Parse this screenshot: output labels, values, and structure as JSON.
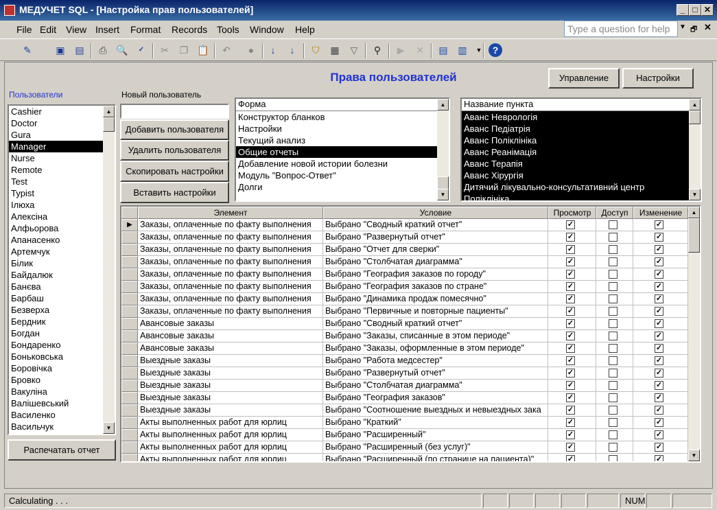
{
  "window": {
    "title": "МЕДУЧЕТ SQL - [Настройка прав пользователей]",
    "minimize": "_",
    "maximize": "□",
    "close": "✕"
  },
  "menu": {
    "items": [
      "File",
      "Edit",
      "View",
      "Insert",
      "Format",
      "Records",
      "Tools",
      "Window",
      "Help"
    ],
    "help_placeholder": "Type a question for help"
  },
  "toolbar": {
    "icons": [
      "design-view-icon",
      "save-icon",
      "file-search-icon",
      "print-icon",
      "print-preview-icon",
      "spelling-icon",
      "cut-icon",
      "copy-icon",
      "paste-icon",
      "undo-icon",
      "hyperlink-icon",
      "sort-ascending-icon",
      "sort-descending-icon",
      "filter-by-selection-icon",
      "filter-by-form-icon",
      "apply-filter-icon",
      "find-icon",
      "new-record-icon",
      "delete-record-icon",
      "database-window-icon",
      "new-object-icon",
      "help-icon"
    ]
  },
  "form": {
    "title": "Права пользователей",
    "btn_manage": "Управление",
    "btn_settings": "Настройки",
    "users_label": "Пользователи",
    "new_user_label": "Новый пользователь",
    "new_user_value": "",
    "btn_add_user": "Добавить пользователя",
    "btn_delete_user": "Удалить пользователя",
    "btn_copy_settings": "Скопировать настройки",
    "btn_paste_settings": "Вставить настройки",
    "btn_print_report": "Распечатать отчет"
  },
  "users": [
    "Cashier",
    "Doctor",
    "Gura",
    "Manager",
    "Nurse",
    "Remote",
    "Test",
    "Typist",
    "Ілюха",
    "Алексіна",
    "Алфьорова",
    "Апанасенко",
    "Артемчук",
    "Білик",
    "Байдалюк",
    "Банєва",
    "Барбаш",
    "Безверха",
    "Бердник",
    "Богдан",
    "Бондаренко",
    "Боньковська",
    "Боровічка",
    "Бровко",
    "Вакуліна",
    "Валішевський",
    "Василенко",
    "Васильчук"
  ],
  "users_selected": "Manager",
  "forms": {
    "header": "Форма",
    "items": [
      "Конструктор бланков",
      "Настройки",
      "Текущий анализ",
      "Общие отчеты",
      "Добавление новой истории болезни",
      "Модуль \"Вопрос-Ответ\"",
      "Долги"
    ],
    "selected": "Общие отчеты"
  },
  "points": {
    "header": "Название пункта",
    "items": [
      "Аванс Неврологія",
      "Аванс Педіатрія",
      "Аванс Поліклініка",
      "Аванс Реанімація",
      "Аванс Терапія",
      "Аванс Хірургія",
      "Дитячий лікувально-консультативний центр",
      "Поліклініка"
    ]
  },
  "grid": {
    "columns": [
      "Элемент",
      "Условие",
      "Просмотр",
      "Доступ",
      "Изменение"
    ],
    "rows": [
      {
        "element": "Заказы, оплаченные по факту выполнения",
        "condition": "Выбрано \"Сводный краткий отчет\"",
        "view": true,
        "access": false,
        "edit": true
      },
      {
        "element": "Заказы, оплаченные по факту выполнения",
        "condition": "Выбрано \"Развернутый отчет\"",
        "view": true,
        "access": false,
        "edit": true
      },
      {
        "element": "Заказы, оплаченные по факту выполнения",
        "condition": "Выбрано \"Отчет для сверки\"",
        "view": true,
        "access": false,
        "edit": true
      },
      {
        "element": "Заказы, оплаченные по факту выполнения",
        "condition": "Выбрано \"Столбчатая диаграмма\"",
        "view": true,
        "access": false,
        "edit": true
      },
      {
        "element": "Заказы, оплаченные по факту выполнения",
        "condition": "Выбрано \"География заказов по городу\"",
        "view": true,
        "access": false,
        "edit": true
      },
      {
        "element": "Заказы, оплаченные по факту выполнения",
        "condition": "Выбрано \"География заказов по стране\"",
        "view": true,
        "access": false,
        "edit": true
      },
      {
        "element": "Заказы, оплаченные по факту выполнения",
        "condition": "Выбрано \"Динамика продаж помесячно\"",
        "view": true,
        "access": false,
        "edit": true
      },
      {
        "element": "Заказы, оплаченные по факту выполнения",
        "condition": "Выбрано \"Первичные и повторные пациенты\"",
        "view": true,
        "access": false,
        "edit": true
      },
      {
        "element": "Авансовые заказы",
        "condition": "Выбрано \"Сводный краткий отчет\"",
        "view": true,
        "access": false,
        "edit": true
      },
      {
        "element": "Авансовые заказы",
        "condition": "Выбрано \"Заказы, списанные в этом периоде\"",
        "view": true,
        "access": false,
        "edit": true
      },
      {
        "element": "Авансовые заказы",
        "condition": "Выбрано \"Заказы, оформленные в этом периоде\"",
        "view": true,
        "access": false,
        "edit": true
      },
      {
        "element": "Выездные заказы",
        "condition": "Выбрано \"Работа медсестер\"",
        "view": true,
        "access": false,
        "edit": true
      },
      {
        "element": "Выездные заказы",
        "condition": "Выбрано \"Развернутый отчет\"",
        "view": true,
        "access": false,
        "edit": true
      },
      {
        "element": "Выездные заказы",
        "condition": "Выбрано \"Столбчатая диаграмма\"",
        "view": true,
        "access": false,
        "edit": true
      },
      {
        "element": "Выездные заказы",
        "condition": "Выбрано \"География заказов\"",
        "view": true,
        "access": false,
        "edit": true
      },
      {
        "element": "Выездные заказы",
        "condition": "Выбрано \"Соотношение выездных и невыездных зака",
        "view": true,
        "access": false,
        "edit": true
      },
      {
        "element": "Акты выполненных работ для юрлиц",
        "condition": "Выбрано \"Краткий\"",
        "view": true,
        "access": false,
        "edit": true
      },
      {
        "element": "Акты выполненных работ для юрлиц",
        "condition": "Выбрано \"Расширенный\"",
        "view": true,
        "access": false,
        "edit": true
      },
      {
        "element": "Акты выполненных работ для юрлиц",
        "condition": "Выбрано \"Расширенный (без услуг)\"",
        "view": true,
        "access": false,
        "edit": true
      },
      {
        "element": "Акты выполненных работ для юрлиц",
        "condition": "Выбрано \"Расширенный (по странице на пациента)\"",
        "view": true,
        "access": false,
        "edit": true
      }
    ]
  },
  "status": {
    "text": "Calculating . . .",
    "num": "NUM"
  }
}
